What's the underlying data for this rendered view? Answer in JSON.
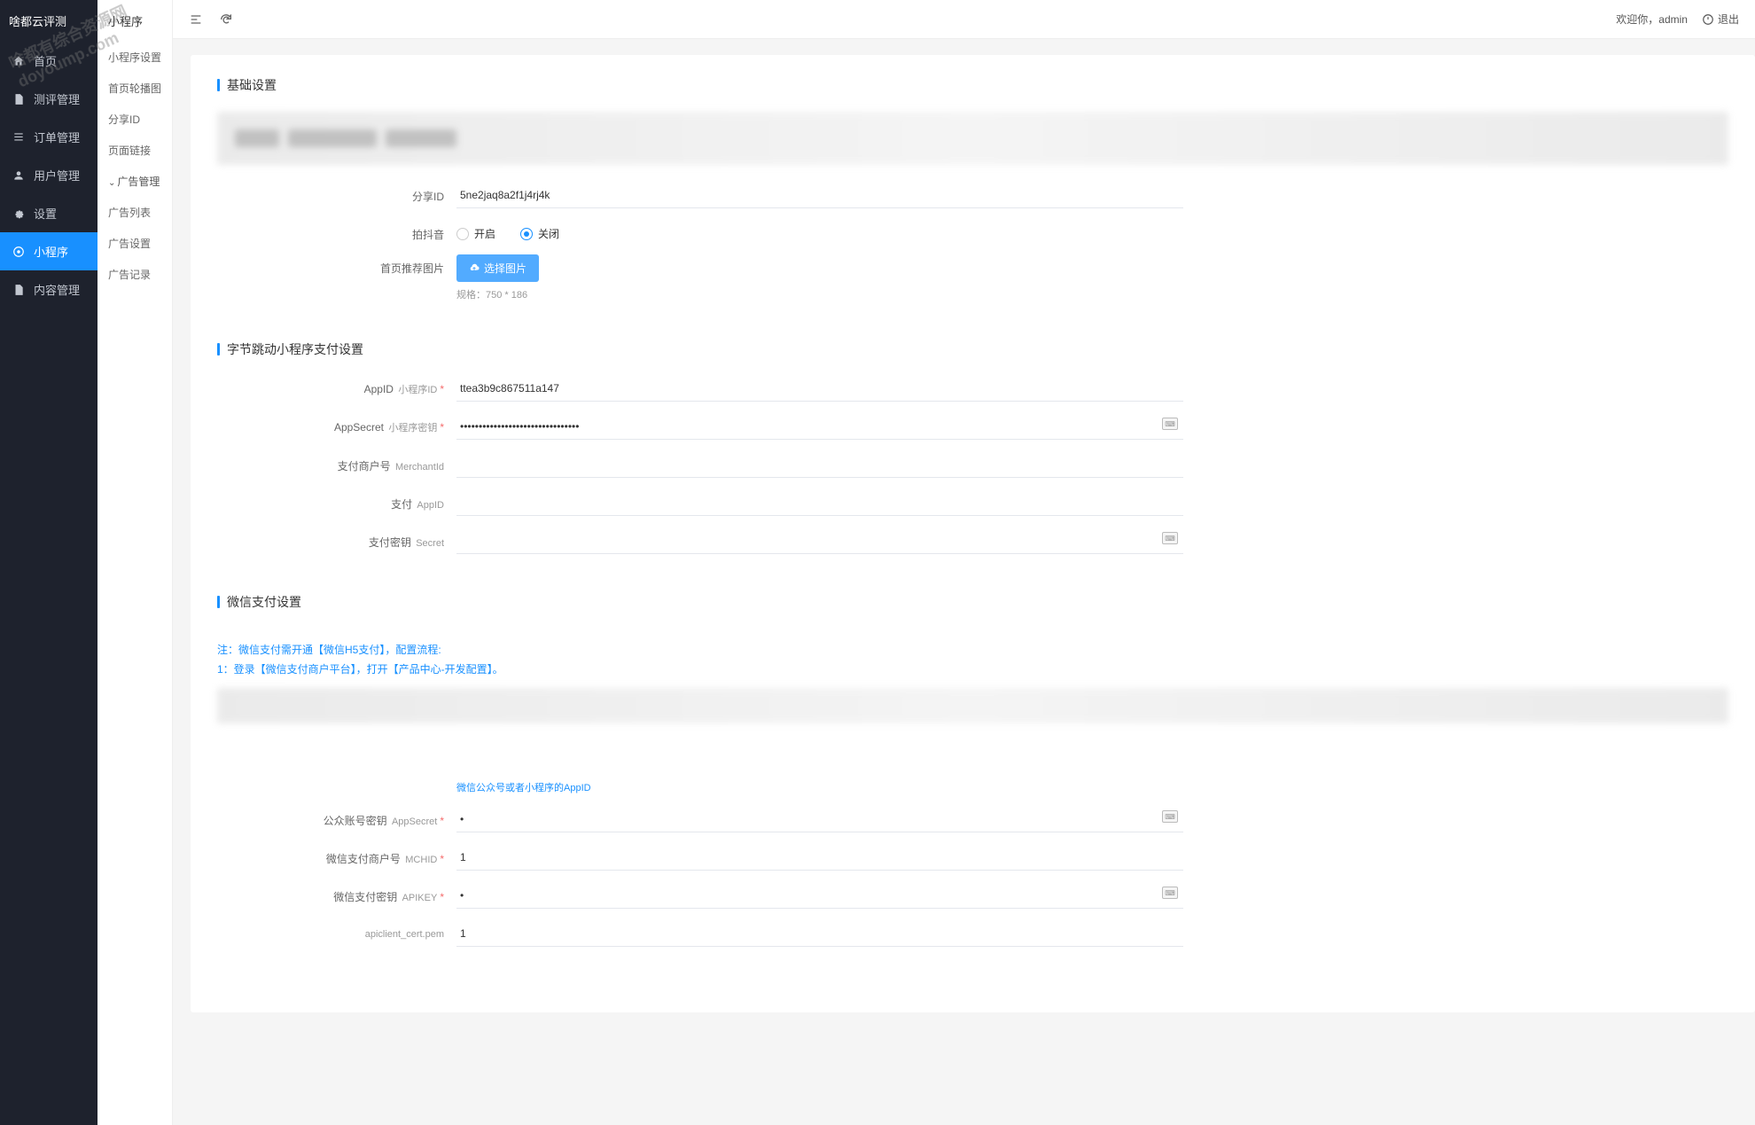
{
  "logo": "啥都云评测",
  "watermark": {
    "line1": "啥都有综合资源网",
    "line2": "doyoump.com"
  },
  "topbar": {
    "welcome": "欢迎你，",
    "user": "admin",
    "logout": "退出"
  },
  "main_nav": [
    {
      "id": "home",
      "label": "首页",
      "icon": "home"
    },
    {
      "id": "review",
      "label": "测评管理",
      "icon": "doc"
    },
    {
      "id": "order",
      "label": "订单管理",
      "icon": "list"
    },
    {
      "id": "user",
      "label": "用户管理",
      "icon": "user"
    },
    {
      "id": "settings",
      "label": "设置",
      "icon": "gear"
    },
    {
      "id": "miniapp",
      "label": "小程序",
      "icon": "app",
      "active": true
    },
    {
      "id": "content",
      "label": "内容管理",
      "icon": "doc"
    }
  ],
  "sub_nav": {
    "title": "小程序",
    "items": [
      {
        "label": "小程序设置"
      },
      {
        "label": "首页轮播图"
      },
      {
        "label": "分享ID"
      },
      {
        "label": "页面链接"
      },
      {
        "label": "广告管理",
        "parent": true
      },
      {
        "label": "广告列表"
      },
      {
        "label": "广告设置"
      },
      {
        "label": "广告记录"
      }
    ]
  },
  "sections": {
    "basic": {
      "title": "基础设置"
    },
    "bytedance": {
      "title": "字节跳动小程序支付设置"
    },
    "wechat": {
      "title": "微信支付设置"
    }
  },
  "form": {
    "share_id": {
      "label": "分享ID",
      "value": "5ne2jaq8a2f1j4rj4k"
    },
    "douyin": {
      "label": "拍抖音",
      "open": "开启",
      "close": "关闭",
      "value": "close"
    },
    "home_image": {
      "label": "首页推荐图片",
      "button": "选择图片",
      "hint": "规格：750 * 186"
    },
    "bd_appid": {
      "label": "AppID",
      "sub": "小程序ID",
      "value": "ttea3b9c867511a147"
    },
    "bd_secret": {
      "label": "AppSecret",
      "sub": "小程序密钥",
      "value": "••••••••••••••••••••••••••••••••"
    },
    "bd_merchant": {
      "label": "支付商户号",
      "sub": "MerchantId",
      "value": ""
    },
    "bd_pay_appid": {
      "label": "支付",
      "sub": "AppID",
      "value": ""
    },
    "bd_pay_secret": {
      "label": "支付密钥",
      "sub": "Secret",
      "value": ""
    },
    "wx_appid_hint": "微信公众号或者小程序的AppID",
    "wx_appsecret": {
      "label": "公众账号密钥",
      "sub": "AppSecret",
      "value": "•"
    },
    "wx_mchid": {
      "label": "微信支付商户号",
      "sub": "MCHID",
      "value": "1"
    },
    "wx_apikey": {
      "label": "微信支付密钥",
      "sub": "APIKEY",
      "value": "•"
    },
    "wx_cert": {
      "label": "apiclient_cert.pem",
      "value": "1"
    }
  },
  "notice": {
    "line1": "注：微信支付需开通【微信H5支付】，配置流程:",
    "line2": "1：登录【微信支付商户平台】，打开【产品中心-开发配置】。"
  }
}
